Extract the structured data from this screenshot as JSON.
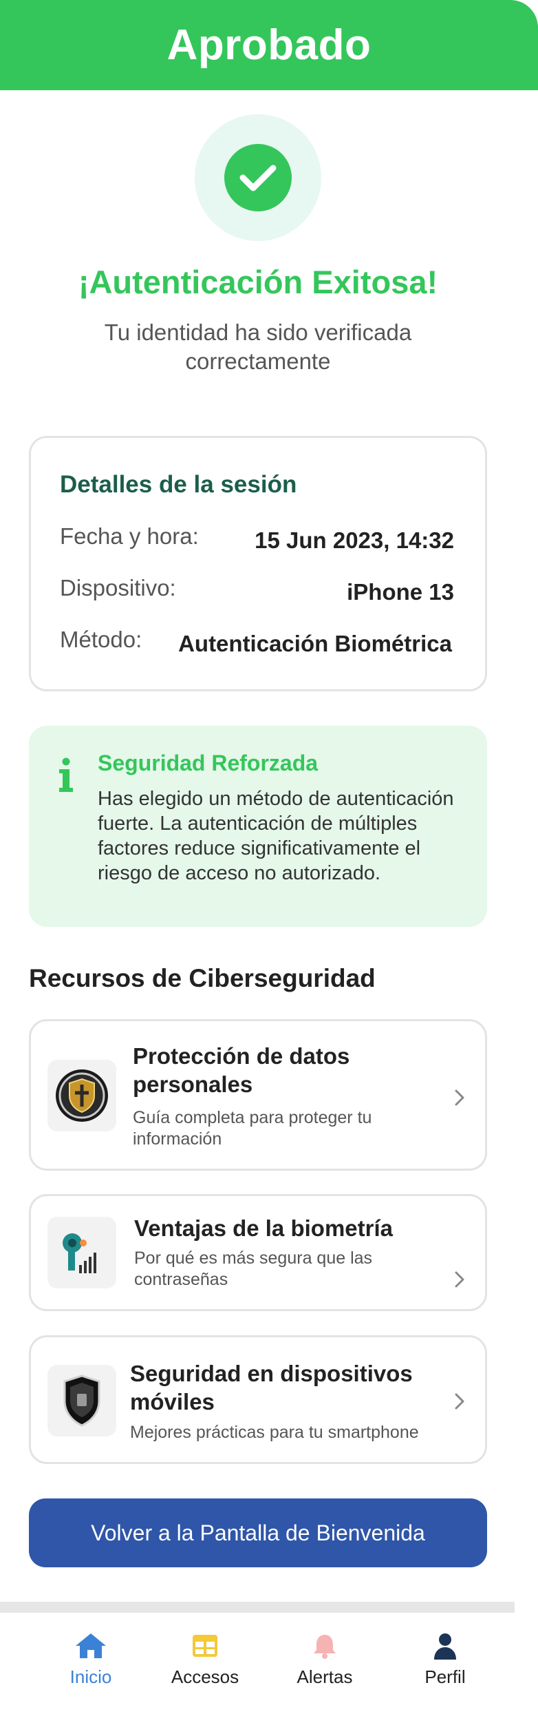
{
  "header": {
    "title": "Aprobado"
  },
  "success": {
    "title": "¡Autenticación Exitosa!",
    "subtitle": "Tu identidad ha sido verificada correctamente"
  },
  "session": {
    "title": "Detalles de la sesión",
    "rows": [
      {
        "label": "Fecha y hora:",
        "value": "15 Jun 2023, 14:32"
      },
      {
        "label": "Dispositivo:",
        "value": "iPhone 13"
      },
      {
        "label": "Método:",
        "value": "Autenticación Biométrica"
      }
    ]
  },
  "info": {
    "title": "Seguridad Reforzada",
    "text": "Has elegido un método de autenticación fuerte. La autenticación de múltiples factores reduce significativamente el riesgo de acceso no autorizado."
  },
  "resources": {
    "title": "Recursos de Ciberseguridad",
    "items": [
      {
        "title": "Protección de datos personales",
        "desc": "Guía completa para proteger tu información",
        "icon": "shield-emblem-icon"
      },
      {
        "title": "Ventajas de la biometría",
        "desc": "Por qué es más segura que las contraseñas",
        "icon": "biometric-scanner-icon"
      },
      {
        "title": "Seguridad en dispositivos móviles",
        "desc": "Mejores prácticas para tu smartphone",
        "icon": "mobile-shield-icon"
      }
    ]
  },
  "primary_button": {
    "label": "Volver a la Pantalla de Bienvenida"
  },
  "nav": {
    "items": [
      {
        "label": "Inicio",
        "icon": "home-icon",
        "active": true
      },
      {
        "label": "Accesos",
        "icon": "grid-icon",
        "active": false
      },
      {
        "label": "Alertas",
        "icon": "bell-icon",
        "active": false
      },
      {
        "label": "Perfil",
        "icon": "user-icon",
        "active": false
      }
    ]
  },
  "colors": {
    "accent_green": "#34c65b",
    "primary_blue": "#2f56a8",
    "active_nav": "#3b82d6",
    "session_title": "#1b5e4a"
  }
}
